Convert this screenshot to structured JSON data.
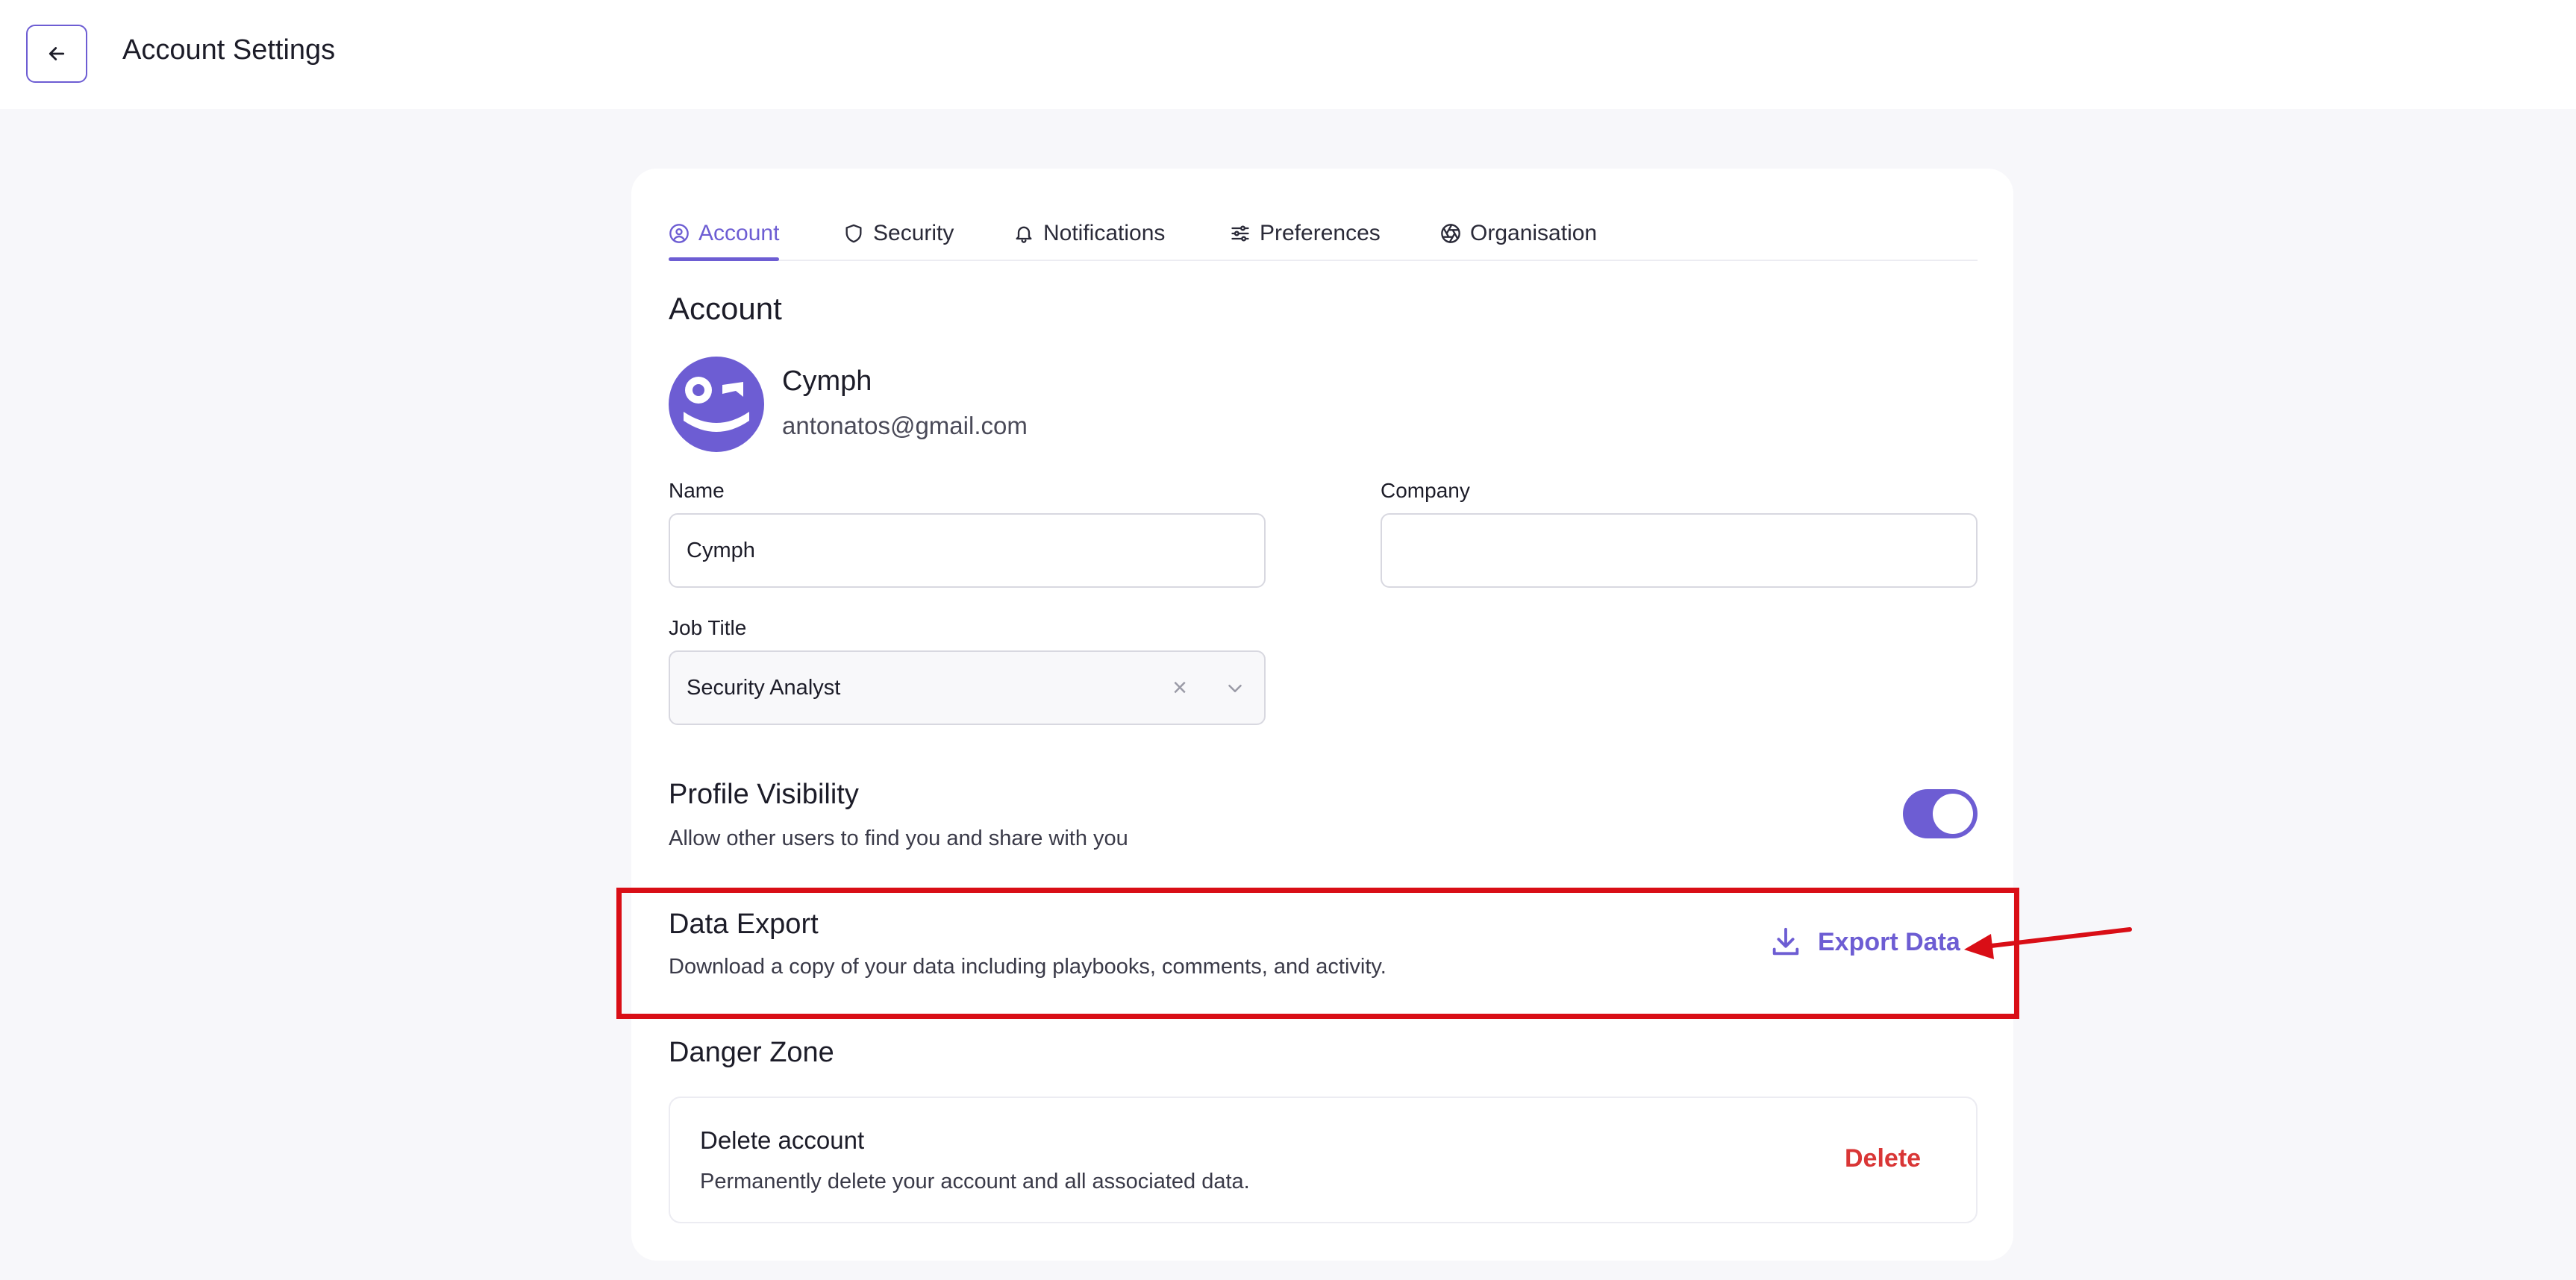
{
  "header": {
    "title": "Account Settings",
    "back_icon": "arrow-left-icon"
  },
  "tabs": [
    {
      "label": "Account",
      "icon": "user-circle-icon",
      "active": true
    },
    {
      "label": "Security",
      "icon": "shield-icon",
      "active": false
    },
    {
      "label": "Notifications",
      "icon": "bell-icon",
      "active": false
    },
    {
      "label": "Preferences",
      "icon": "sliders-icon",
      "active": false
    },
    {
      "label": "Organisation",
      "icon": "aperture-icon",
      "active": false
    }
  ],
  "account": {
    "section_title": "Account",
    "user": {
      "name": "Cymph",
      "email": "antonatos@gmail.com"
    },
    "fields": {
      "name": {
        "label": "Name",
        "value": "Cymph"
      },
      "company": {
        "label": "Company",
        "value": ""
      },
      "job_title": {
        "label": "Job Title",
        "value": "Security Analyst"
      }
    }
  },
  "profile_visibility": {
    "title": "Profile Visibility",
    "description": "Allow other users to find you and share with you",
    "enabled": true
  },
  "data_export": {
    "title": "Data Export",
    "description": "Download a copy of your data including playbooks, comments, and activity.",
    "button_label": "Export Data",
    "button_icon": "download-icon"
  },
  "danger_zone": {
    "title": "Danger Zone",
    "delete_title": "Delete account",
    "delete_description": "Permanently delete your account and all associated data.",
    "delete_label": "Delete"
  },
  "colors": {
    "accent": "#6d5dd3",
    "danger": "#d93636",
    "annotation": "#d90e16",
    "background": "#f7f7fa"
  }
}
